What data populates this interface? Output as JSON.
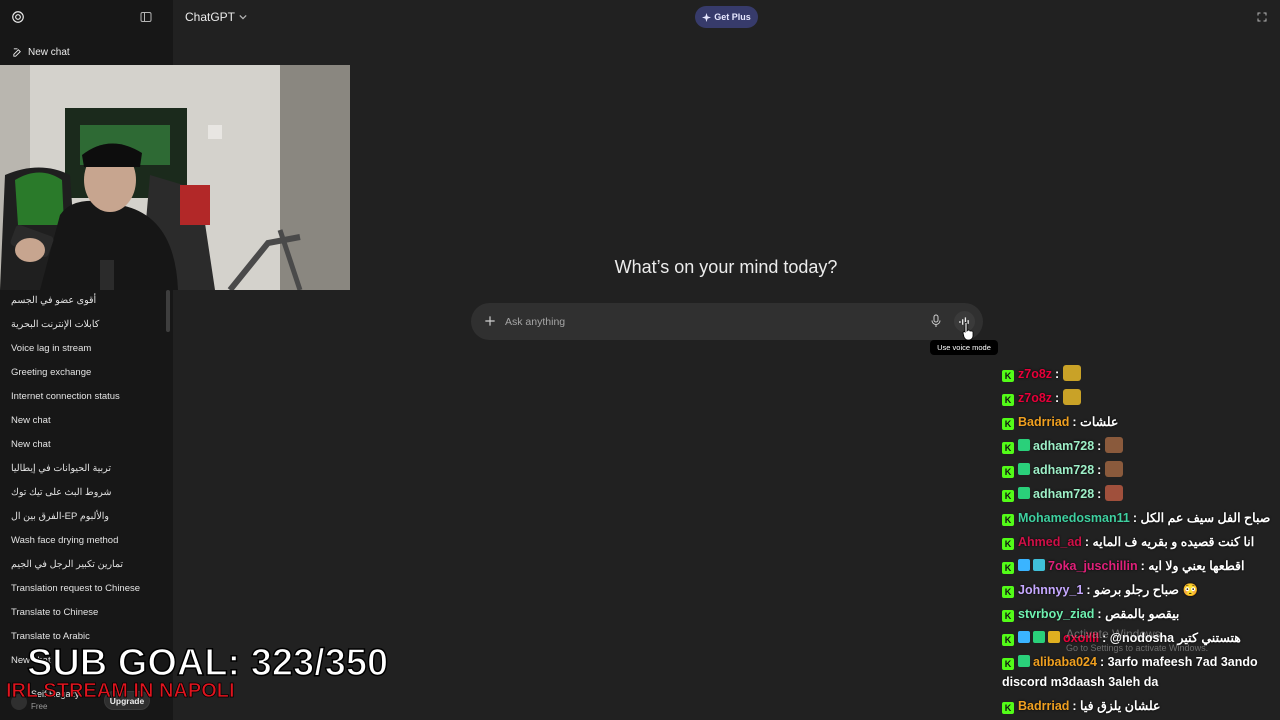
{
  "sidebar": {
    "new_chat_label": "New chat",
    "history": [
      "أقوى عضو في الجسم",
      "كابلات الإنترنت البحرية",
      "Voice lag in stream",
      "Greeting exchange",
      "Internet connection status",
      "New chat",
      "New chat",
      "تربية الحيوانات في إيطاليا",
      "شروط البث على تيك توك",
      "الفرق بين ال-EP والألبوم",
      "Wash face drying method",
      "تمارين تكبير الرجل في الجيم",
      "Translation request to Chinese",
      "Translate to Chinese",
      "Translate to Arabic",
      "New chat"
    ],
    "user": {
      "name": "Seif Hegazy",
      "plan": "Free"
    },
    "upgrade_label": "Upgrade"
  },
  "header": {
    "model": "ChatGPT",
    "get_plus_label": "Get Plus"
  },
  "main": {
    "headline": "What’s on your mind today?",
    "composer_placeholder": "Ask anything",
    "voice_tooltip": "Use voice mode"
  },
  "overlay": {
    "sub_goal": "SUB GOAL: 323/350",
    "stream_title": "IRL STREAM IN NAPOLI",
    "watermark_title": "Activate Windows",
    "watermark_sub": "Go to Settings to activate Windows."
  },
  "chat": [
    {
      "user": "z7o8z",
      "color": "#e8003a",
      "text": "",
      "emote": "#c9a227",
      "badges": [
        "kick"
      ]
    },
    {
      "user": "z7o8z",
      "color": "#e8003a",
      "text": "",
      "emote": "#c9a227",
      "badges": [
        "kick"
      ]
    },
    {
      "user": "Badrriad",
      "color": "#f0a020",
      "text": "علشات",
      "emote": "",
      "badges": [
        "kick"
      ]
    },
    {
      "user": "adham728",
      "color": "#9ef0c8",
      "text": "",
      "emote": "#8a5a3c",
      "badges": [
        "kick",
        "star"
      ]
    },
    {
      "user": "adham728",
      "color": "#9ef0c8",
      "text": "",
      "emote": "#8a5a3c",
      "badges": [
        "kick",
        "star"
      ]
    },
    {
      "user": "adham728",
      "color": "#9ef0c8",
      "text": "",
      "emote": "#a0503c",
      "badges": [
        "kick",
        "star"
      ]
    },
    {
      "user": "Mohamedosman11",
      "color": "#3fd0a0",
      "text": "صباح الفل سيف عم الكل",
      "emote": "",
      "badges": [
        "kick"
      ]
    },
    {
      "user": "Ahmed_ad",
      "color": "#d01048",
      "text": "انا كنت قصيده و بقريه ف المايه",
      "emote": "",
      "badges": [
        "kick"
      ]
    },
    {
      "user": "7oka_juschillin",
      "color": "#e0207a",
      "text": "اقطعها يعني ولا ايه",
      "emote": "",
      "badges": [
        "kick",
        "gift",
        "grid"
      ]
    },
    {
      "user": "Johnnyy_1",
      "color": "#c6a8ff",
      "text": "صباح رجلو برضو 😳",
      "emote": "",
      "badges": [
        "kick"
      ]
    },
    {
      "user": "stvrboy_ziad",
      "color": "#6ff0b0",
      "text": "بيقصو بالمقص",
      "emote": "",
      "badges": [
        "kick"
      ]
    },
    {
      "user": "oxoilll",
      "color": "#e8003a",
      "text": "@nodosha هتستني كتير",
      "emote": "",
      "badges": [
        "kick",
        "gift",
        "star",
        "crown"
      ]
    },
    {
      "user": "alibaba024",
      "color": "#f0a020",
      "text": "3arfo mafeesh 7ad 3ando discord m3daash 3aleh da",
      "emote": "",
      "badges": [
        "kick",
        "star"
      ]
    },
    {
      "user": "Badrriad",
      "color": "#f0a020",
      "text": "علشان يلزق فيا",
      "emote": "",
      "badges": [
        "kick"
      ]
    }
  ]
}
